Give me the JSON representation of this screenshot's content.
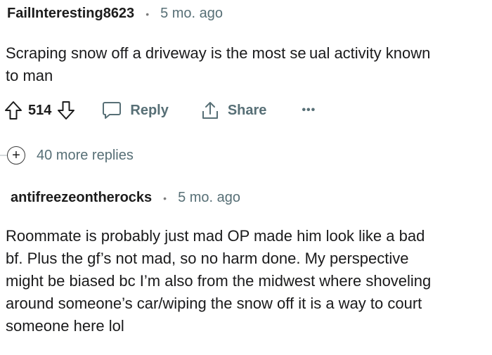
{
  "comment1": {
    "username": "FailInteresting8623",
    "separator": "•",
    "timestamp": "5 mo. ago",
    "text": "Scraping snow off a driveway is the most se ual activity known\nto man",
    "upvote_icon": "arrow-up-outline-icon",
    "downvote_icon": "arrow-down-outline-icon",
    "score": "514",
    "reply_label": "Reply",
    "share_label": "Share",
    "more_label": "•••"
  },
  "more_replies": {
    "icon": "plus-circle-icon",
    "label": "40 more replies"
  },
  "comment2": {
    "username": "antifreezeontherocks",
    "separator": "•",
    "timestamp": "5 mo. ago",
    "text": "Roommate is probably just mad OP made him look like a bad\nbf. Plus the gf’s not mad, so no harm done. My perspective\nmight be biased bc I’m also from the midwest where shoveling\naround someone’s car/wiping the snow off it is a way to court\nsomeone here lol"
  },
  "colors": {
    "text_primary": "#1a1a1b",
    "text_meta": "#576f76",
    "thread_line": "#d5dadc"
  }
}
